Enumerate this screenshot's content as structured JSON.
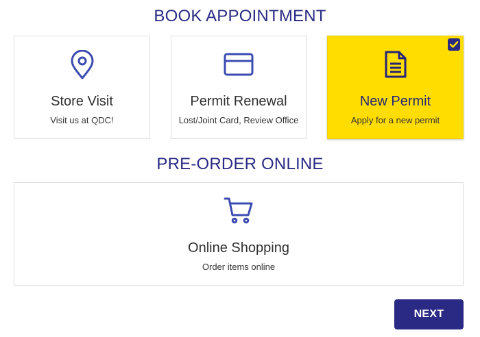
{
  "book_section": {
    "title": "BOOK APPOINTMENT",
    "cards": [
      {
        "name": "Store Visit",
        "subtitle": "Visit us at QDC!",
        "icon": "map-pin-icon",
        "selected": false
      },
      {
        "name": "Permit Renewal",
        "subtitle": "Lost/Joint Card, Review Office",
        "icon": "credit-card-icon",
        "selected": false
      },
      {
        "name": "New Permit",
        "subtitle": "Apply for a new permit",
        "icon": "document-icon",
        "selected": true
      }
    ]
  },
  "preorder_section": {
    "title": "PRE-ORDER ONLINE",
    "cards": [
      {
        "name": "Online Shopping",
        "subtitle": "Order items online",
        "icon": "shopping-cart-icon",
        "selected": false
      }
    ]
  },
  "actions": {
    "next_label": "NEXT"
  },
  "colors": {
    "accent": "#2a2a84",
    "selected_bg": "#ffdd00",
    "icon": "#3b4bb0"
  }
}
